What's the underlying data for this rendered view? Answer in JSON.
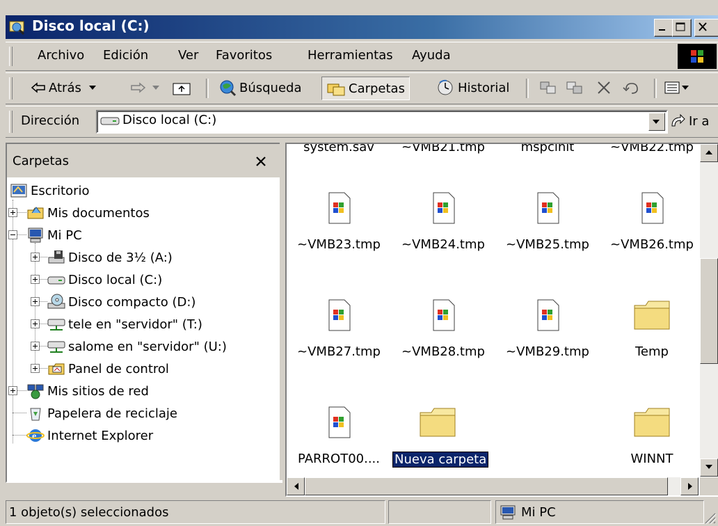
{
  "window": {
    "title": "Disco local (C:)"
  },
  "menu": [
    "Archivo",
    "Edición",
    "Ver",
    "Favoritos",
    "Herramientas",
    "Ayuda"
  ],
  "toolbar": {
    "back": "Atrás",
    "search": "Búsqueda",
    "folders": "Carpetas",
    "history": "Historial"
  },
  "address": {
    "label": "Dirección",
    "value": "Disco local (C:)",
    "go": "Ir a"
  },
  "folders_pane": {
    "title": "Carpetas",
    "tree": [
      {
        "label": "Escritorio",
        "icon": "desktop-icon"
      },
      {
        "label": "Mis documentos",
        "icon": "folder-docs-icon"
      },
      {
        "label": "Mi PC",
        "icon": "computer-icon"
      },
      {
        "label": "Disco de 3½ (A:)",
        "icon": "floppy-icon"
      },
      {
        "label": "Disco local (C:)",
        "icon": "hard-drive-icon"
      },
      {
        "label": "Disco compacto (D:)",
        "icon": "cd-drive-icon"
      },
      {
        "label": "tele en \"servidor\" (T:)",
        "icon": "network-drive-icon"
      },
      {
        "label": "salome en \"servidor\" (U:)",
        "icon": "network-drive-icon"
      },
      {
        "label": "Panel de control",
        "icon": "control-panel-icon"
      },
      {
        "label": "Mis sitios de red",
        "icon": "network-places-icon"
      },
      {
        "label": "Papelera de reciclaje",
        "icon": "recycle-bin-icon"
      },
      {
        "label": "Internet Explorer",
        "icon": "internet-explorer-icon"
      }
    ]
  },
  "files": {
    "top_partial": [
      "system.sav",
      "~VMB21.tmp",
      "mspcinit",
      "~VMB22.tmp"
    ],
    "row1": [
      "~VMB23.tmp",
      "~VMB24.tmp",
      "~VMB25.tmp",
      "~VMB26.tmp"
    ],
    "row2": [
      "~VMB27.tmp",
      "~VMB28.tmp",
      "~VMB29.tmp",
      "Temp"
    ],
    "row3": [
      "PARROT00....",
      "Nueva carpeta",
      "WINNT"
    ]
  },
  "status": {
    "selection": "1 objeto(s) seleccionados",
    "zone": "Mi PC"
  },
  "colors": {
    "title_gradient_start": "#0a246a",
    "title_gradient_end": "#a6caf0",
    "selection": "#0a246a",
    "face": "#d4d0c8"
  }
}
